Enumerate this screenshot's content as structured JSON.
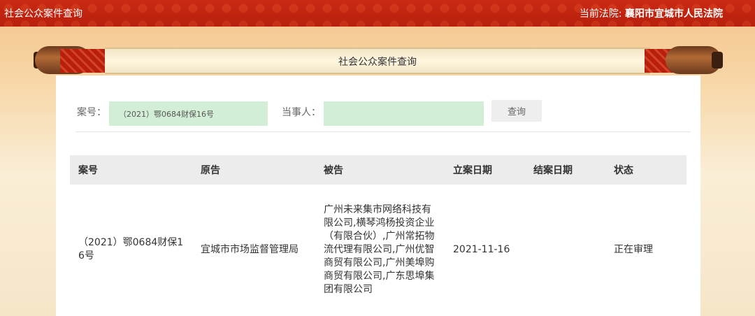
{
  "topbar": {
    "site_title": "社会公众案件查询",
    "court_label": "当前法院:",
    "court_name": "襄阳市宜城市人民法院"
  },
  "banner": {
    "title": "社会公众案件查询"
  },
  "search": {
    "case_no_label": "案号：",
    "case_no_value": "（2021）鄂0684财保16号",
    "party_label": "当事人：",
    "party_value": "",
    "query_button": "查询"
  },
  "table": {
    "columns": [
      "案号",
      "原告",
      "被告",
      "立案日期",
      "结案日期",
      "状态"
    ],
    "rows": [
      {
        "case_no": "（2021）鄂0684财保16号",
        "plaintiff": "宜城市市场监督管理局",
        "defendant": "广州未来集市网络科技有限公司,横琴鸿杨投资企业（有限合伙）,广州常拓物流代理有限公司,广州优智商贸有限公司,广州美埠购商贸有限公司,广东思埠集团有限公司",
        "filing_date": "2021-11-16",
        "closing_date": "",
        "status": "正在审理"
      }
    ]
  },
  "colors": {
    "topbar_red": "#b81f0c",
    "input_green": "#d3eed6",
    "header_gray": "#ececec"
  }
}
